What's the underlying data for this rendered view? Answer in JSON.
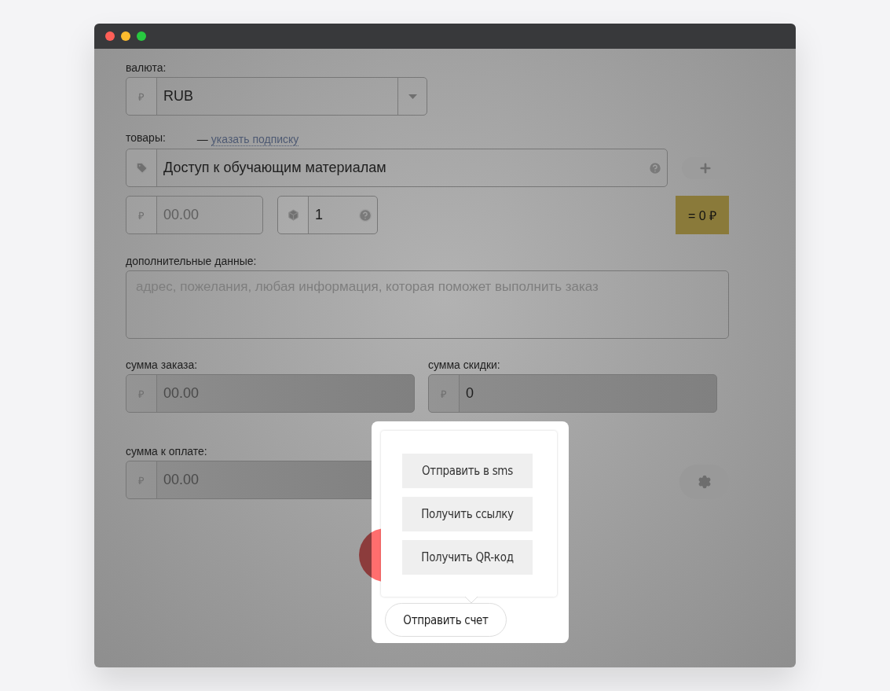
{
  "currency": {
    "label": "валюта:",
    "addon": "₽",
    "value": "RUB"
  },
  "products": {
    "label": "товары:",
    "dash": "—",
    "link": "указать подписку",
    "name": {
      "value": "Доступ к обучающим материалам"
    },
    "price": {
      "addon": "₽",
      "placeholder": "00.00"
    },
    "quantity": {
      "value": "1"
    },
    "total": "= 0 ₽"
  },
  "extra": {
    "label": "дополнительные данные:",
    "placeholder": "адрес, пожелания, любая информация, которая поможет выполнить заказ"
  },
  "sums": [
    {
      "label": "сумма заказа:",
      "addon": "₽",
      "placeholder": "00.00",
      "disabled": true
    },
    {
      "label": "сумма скидки:",
      "addon": "₽",
      "value": "0",
      "disabled": true
    }
  ],
  "payable": {
    "label": "сумма к оплате:",
    "addon": "₽",
    "placeholder": "00.00",
    "disabled": true
  },
  "menu": {
    "items": [
      "Отправить в sms",
      "Получить ссылку",
      "Получить QR-код"
    ],
    "button": "Отправить счет"
  }
}
